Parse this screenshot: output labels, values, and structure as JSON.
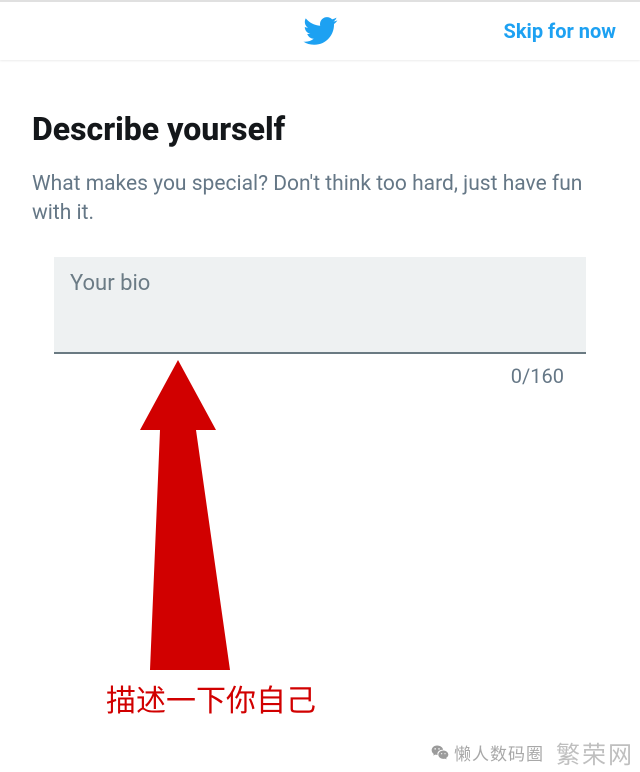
{
  "header": {
    "skip_label": "Skip for now",
    "logo_name": "twitter-bird-icon"
  },
  "main": {
    "title": "Describe yourself",
    "subtitle": "What makes you special? Don't think too hard, just have fun with it.",
    "bio_placeholder": "Your bio",
    "bio_value": "",
    "char_counter": "0/160"
  },
  "annotation": {
    "text": "描述一下你自己",
    "arrow_color": "#d10000"
  },
  "watermark": {
    "source_text": "懒人数码圈",
    "brand": "繁荣网"
  }
}
